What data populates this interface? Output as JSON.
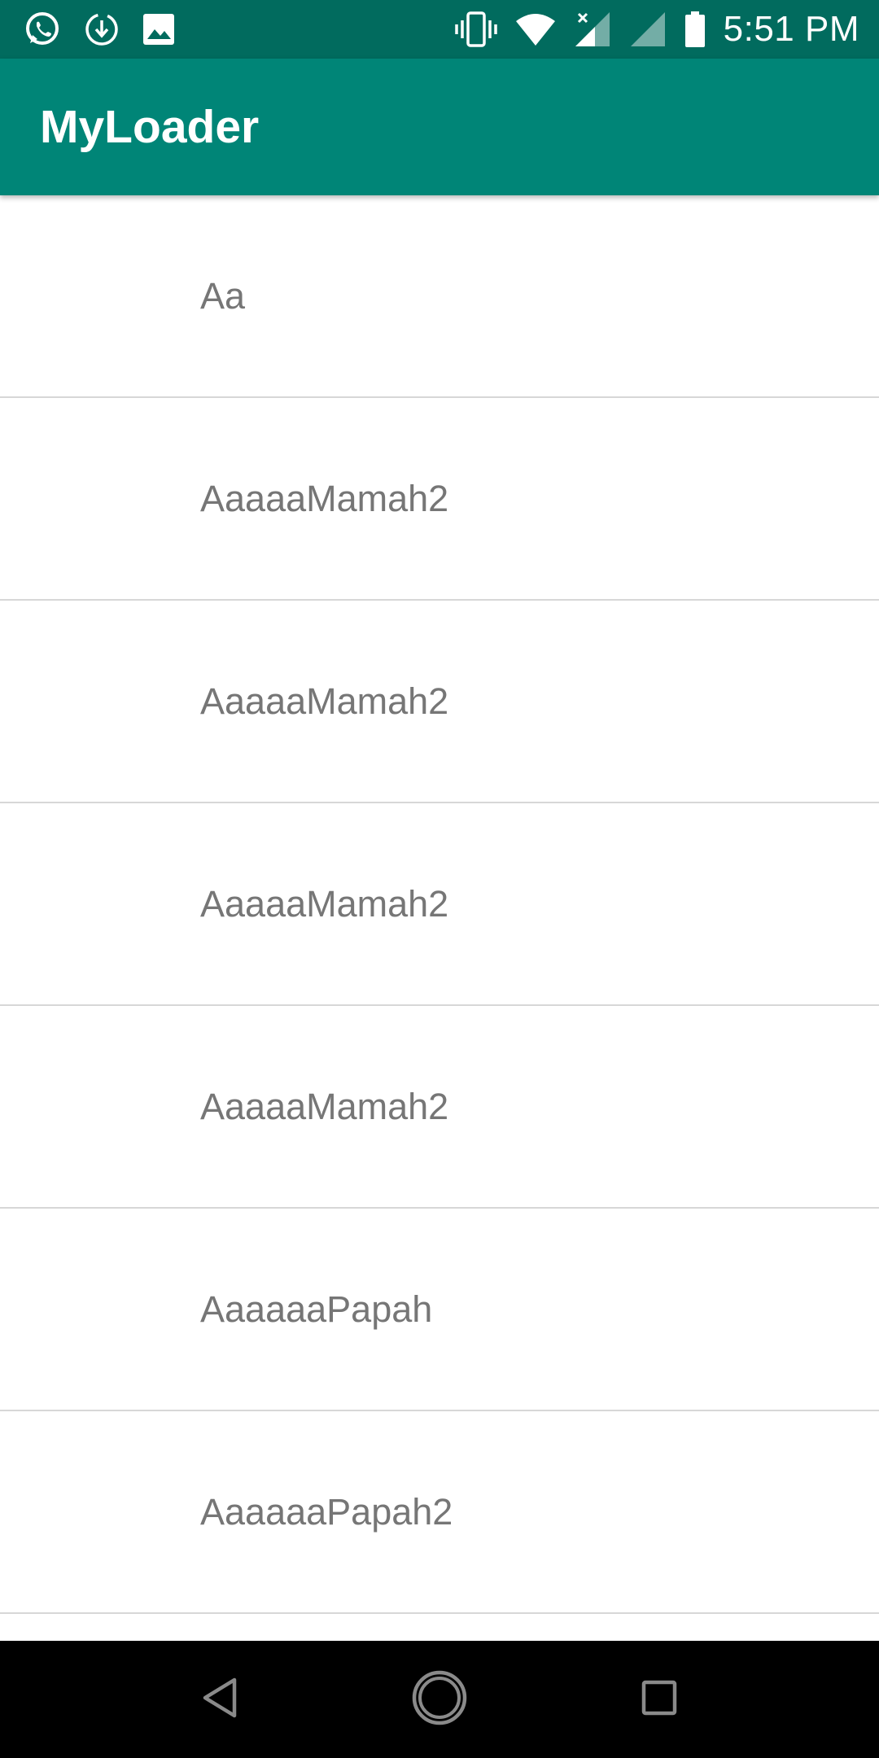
{
  "status_bar": {
    "time": "5:51 PM",
    "left_icons": [
      "whatsapp-icon",
      "download-icon",
      "image-icon"
    ],
    "right_icons": [
      "vibrate-icon",
      "wifi-icon",
      "cell-signal-icon",
      "cell-signal-2-icon",
      "battery-icon"
    ]
  },
  "app_bar": {
    "title": "MyLoader",
    "color": "#008577"
  },
  "list": {
    "items": [
      {
        "label": "Aa"
      },
      {
        "label": "AaaaaMamah2"
      },
      {
        "label": "AaaaaMamah2"
      },
      {
        "label": "AaaaaMamah2"
      },
      {
        "label": "AaaaaMamah2"
      },
      {
        "label": "AaaaaaPapah"
      },
      {
        "label": "AaaaaaPapah2"
      }
    ]
  },
  "nav_bar": {
    "buttons": [
      "back-icon",
      "home-icon",
      "recents-icon"
    ]
  },
  "colors": {
    "status_bar": "#016b5e",
    "app_bar": "#008577",
    "item_text": "#767676",
    "divider": "#d7d7d7"
  }
}
